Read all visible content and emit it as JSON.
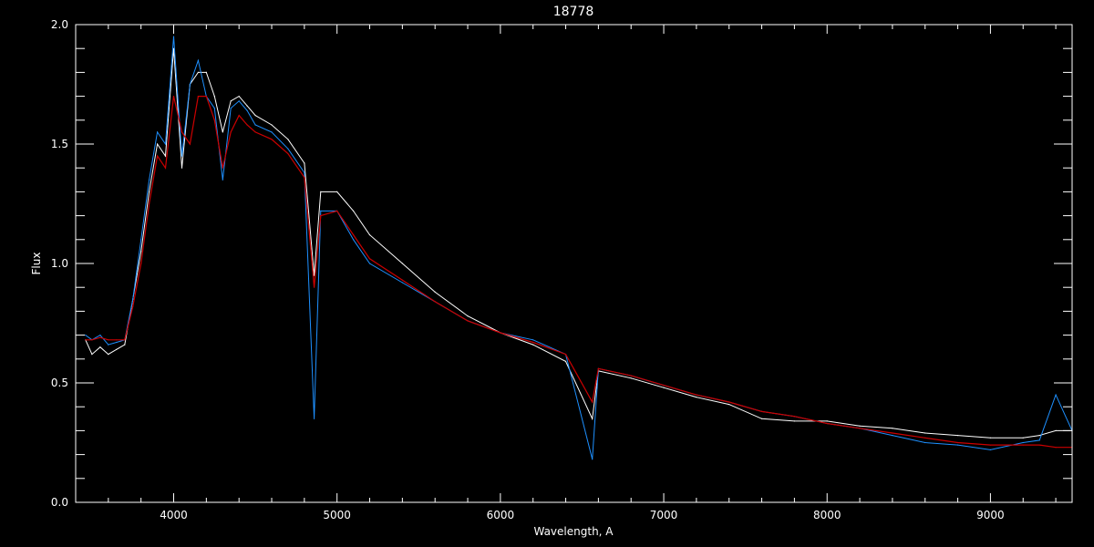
{
  "chart_data": {
    "type": "line",
    "title": "18778",
    "xlabel": "Wavelength, A",
    "ylabel": "Flux",
    "xlim": [
      3400,
      9500
    ],
    "ylim": [
      0,
      2.0
    ],
    "x_ticks": [
      4000,
      5000,
      6000,
      7000,
      8000,
      9000
    ],
    "y_ticks": [
      0.0,
      0.5,
      1.0,
      1.5,
      2.0
    ],
    "y_tick_labels": [
      "0.0",
      "0.5",
      "1.0",
      "1.5",
      "2.0"
    ],
    "grid": false,
    "legend": "none",
    "colors": {
      "background": "#000000",
      "observed": "#ffffff",
      "model": "#1e90ff",
      "fit": "#cc0000",
      "axes": "#ffffff"
    },
    "series": [
      {
        "color": "#ffffff",
        "x": [
          3460,
          3500,
          3550,
          3600,
          3650,
          3700,
          3750,
          3800,
          3850,
          3900,
          3950,
          4000,
          4050,
          4100,
          4150,
          4200,
          4250,
          4300,
          4350,
          4400,
          4450,
          4500,
          4600,
          4700,
          4800,
          4860,
          4900,
          5000,
          5100,
          5200,
          5400,
          5600,
          5800,
          6000,
          6200,
          6400,
          6563,
          6600,
          6800,
          7000,
          7200,
          7400,
          7600,
          7800,
          8000,
          8200,
          8400,
          8600,
          8800,
          9000,
          9200,
          9300,
          9400,
          9500
        ],
        "values": [
          0.68,
          0.62,
          0.65,
          0.62,
          0.64,
          0.66,
          0.85,
          1.05,
          1.3,
          1.5,
          1.45,
          1.9,
          1.4,
          1.75,
          1.8,
          1.8,
          1.7,
          1.55,
          1.68,
          1.7,
          1.66,
          1.62,
          1.58,
          1.52,
          1.42,
          0.95,
          1.3,
          1.3,
          1.22,
          1.12,
          1.0,
          0.88,
          0.78,
          0.71,
          0.66,
          0.59,
          0.35,
          0.55,
          0.52,
          0.48,
          0.44,
          0.41,
          0.35,
          0.34,
          0.34,
          0.32,
          0.31,
          0.29,
          0.28,
          0.27,
          0.27,
          0.28,
          0.3,
          0.3
        ]
      },
      {
        "color": "#1e90ff",
        "x": [
          3460,
          3500,
          3550,
          3600,
          3650,
          3700,
          3750,
          3800,
          3850,
          3900,
          3950,
          4000,
          4050,
          4100,
          4150,
          4200,
          4250,
          4300,
          4350,
          4400,
          4450,
          4500,
          4600,
          4700,
          4800,
          4860,
          4900,
          5000,
          5100,
          5200,
          5400,
          5600,
          5800,
          6000,
          6200,
          6400,
          6563,
          6600,
          6800,
          7000,
          7200,
          7400,
          7600,
          7800,
          8000,
          8200,
          8400,
          8600,
          8800,
          9000,
          9200,
          9300,
          9400,
          9500
        ],
        "values": [
          0.7,
          0.68,
          0.7,
          0.66,
          0.67,
          0.68,
          0.85,
          1.1,
          1.35,
          1.55,
          1.5,
          1.95,
          1.45,
          1.75,
          1.85,
          1.7,
          1.65,
          1.35,
          1.65,
          1.68,
          1.64,
          1.58,
          1.55,
          1.48,
          1.38,
          0.35,
          1.22,
          1.22,
          1.1,
          1.0,
          0.92,
          0.84,
          0.76,
          0.71,
          0.68,
          0.62,
          0.18,
          0.56,
          0.53,
          0.49,
          0.45,
          0.42,
          0.38,
          0.36,
          0.33,
          0.31,
          0.28,
          0.25,
          0.24,
          0.22,
          0.25,
          0.26,
          0.45,
          0.3
        ]
      },
      {
        "color": "#cc0000",
        "x": [
          3460,
          3500,
          3550,
          3600,
          3650,
          3700,
          3750,
          3800,
          3850,
          3900,
          3950,
          4000,
          4050,
          4100,
          4150,
          4200,
          4250,
          4300,
          4350,
          4400,
          4450,
          4500,
          4600,
          4700,
          4800,
          4860,
          4900,
          5000,
          5100,
          5200,
          5400,
          5600,
          5800,
          6000,
          6200,
          6400,
          6563,
          6600,
          6800,
          7000,
          7200,
          7400,
          7600,
          7800,
          8000,
          8200,
          8400,
          8600,
          8800,
          9000,
          9200,
          9300,
          9400,
          9500
        ],
        "values": [
          0.68,
          0.68,
          0.69,
          0.68,
          0.68,
          0.68,
          0.82,
          1.0,
          1.25,
          1.45,
          1.4,
          1.7,
          1.55,
          1.5,
          1.7,
          1.7,
          1.6,
          1.4,
          1.55,
          1.62,
          1.58,
          1.55,
          1.52,
          1.46,
          1.36,
          0.9,
          1.2,
          1.22,
          1.12,
          1.02,
          0.93,
          0.84,
          0.76,
          0.71,
          0.67,
          0.62,
          0.42,
          0.56,
          0.53,
          0.49,
          0.45,
          0.42,
          0.38,
          0.36,
          0.33,
          0.31,
          0.29,
          0.27,
          0.25,
          0.24,
          0.24,
          0.24,
          0.23,
          0.23
        ]
      }
    ]
  }
}
